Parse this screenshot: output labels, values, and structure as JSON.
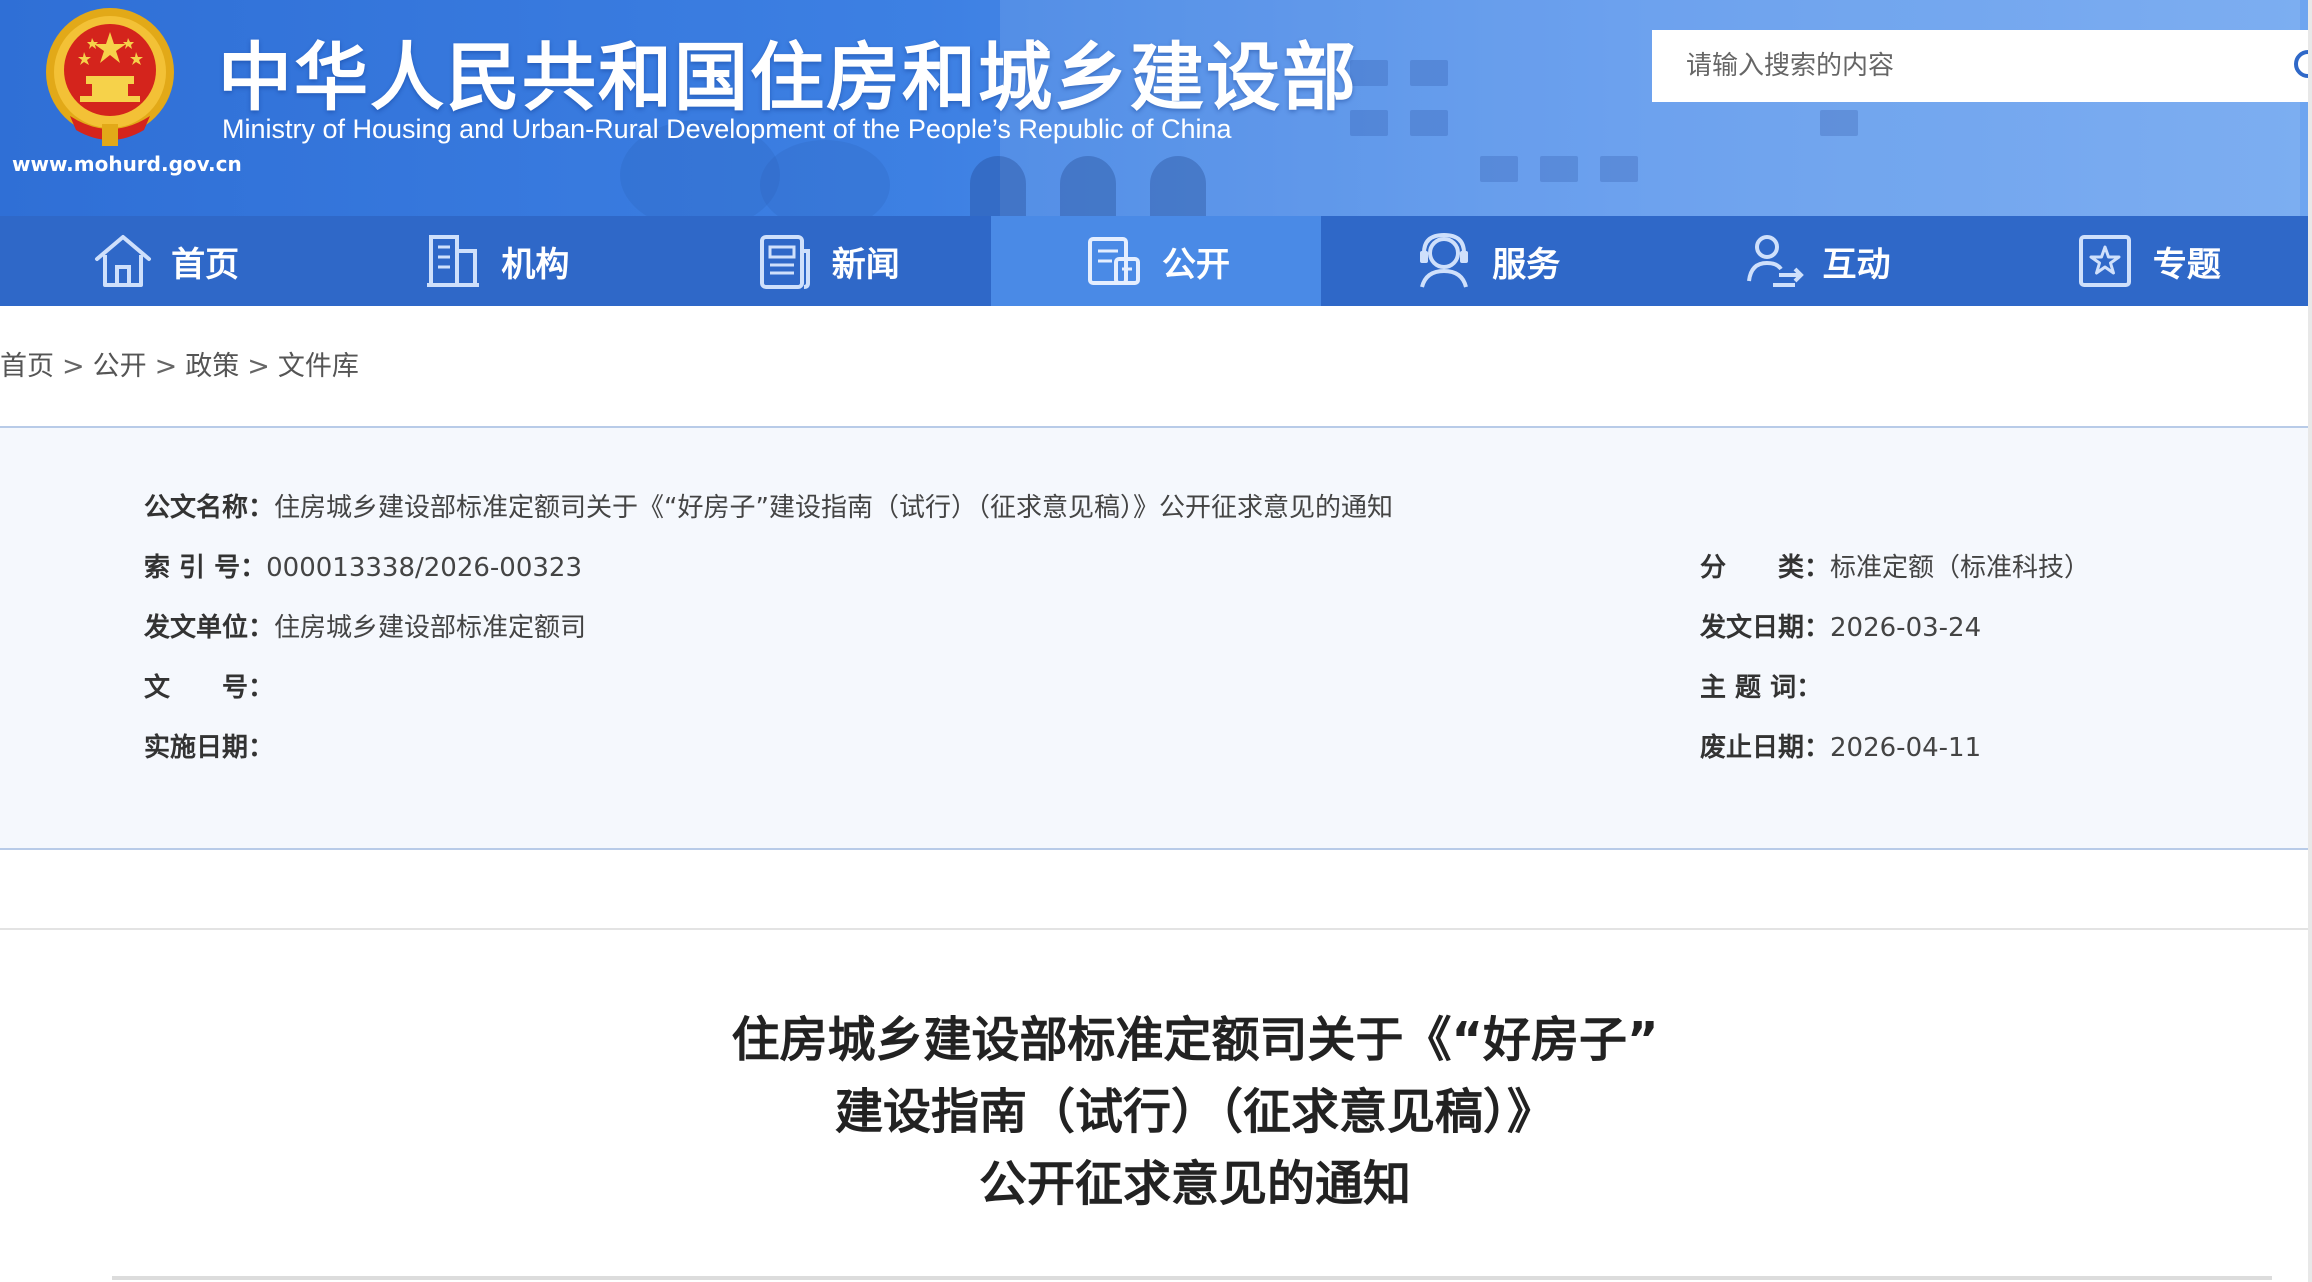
{
  "header": {
    "title_cn": "中华人民共和国住房和城乡建设部",
    "title_en": "Ministry of Housing and Urban-Rural Development of the People’s Republic of China",
    "site_url": "www.mohurd.gov.cn",
    "search_placeholder": "请输入搜索的内容"
  },
  "nav": {
    "items": [
      {
        "label": "首页",
        "icon": "home-icon"
      },
      {
        "label": "机构",
        "icon": "building-icon"
      },
      {
        "label": "新闻",
        "icon": "news-icon"
      },
      {
        "label": "公开",
        "icon": "disclosure-icon",
        "active": true
      },
      {
        "label": "服务",
        "icon": "service-icon"
      },
      {
        "label": "互动",
        "icon": "interaction-icon"
      },
      {
        "label": "专题",
        "icon": "topic-star-icon"
      }
    ]
  },
  "breadcrumb": {
    "items": [
      "首页",
      "公开",
      "政策",
      "文件库"
    ],
    "separator": ">"
  },
  "info": {
    "doc_name_label": "公文名称：",
    "doc_name_value": "住房城乡建设部标准定额司关于《“好房子”建设指南（试行）（征求意见稿）》公开征求意见的通知",
    "index_label": "索 引 号：",
    "index_value": "000013338/2026-00323",
    "category_label": "分　　类：",
    "category_value": "标准定额（标准科技）",
    "issuer_label": "发文单位：",
    "issuer_value": "住房城乡建设部标准定额司",
    "date_label": "发文日期：",
    "date_value": "2026-03-24",
    "docno_label": "文　　号：",
    "docno_value": "",
    "subject_label": "主 题 词：",
    "subject_value": "",
    "effective_label": "实施日期：",
    "effective_value": "",
    "expire_label": "废止日期：",
    "expire_value": "2026-04-11"
  },
  "article": {
    "title_line1": "住房城乡建设部标准定额司关于《“好房子”",
    "title_line2": "建设指南（试行）（征求意见稿）》",
    "title_line3": "公开征求意见的通知"
  },
  "colors": {
    "banner": "#3d80e3",
    "nav": "#2f68c8",
    "nav_active": "#4a8ae6",
    "info_bg": "#f5f8fd"
  }
}
